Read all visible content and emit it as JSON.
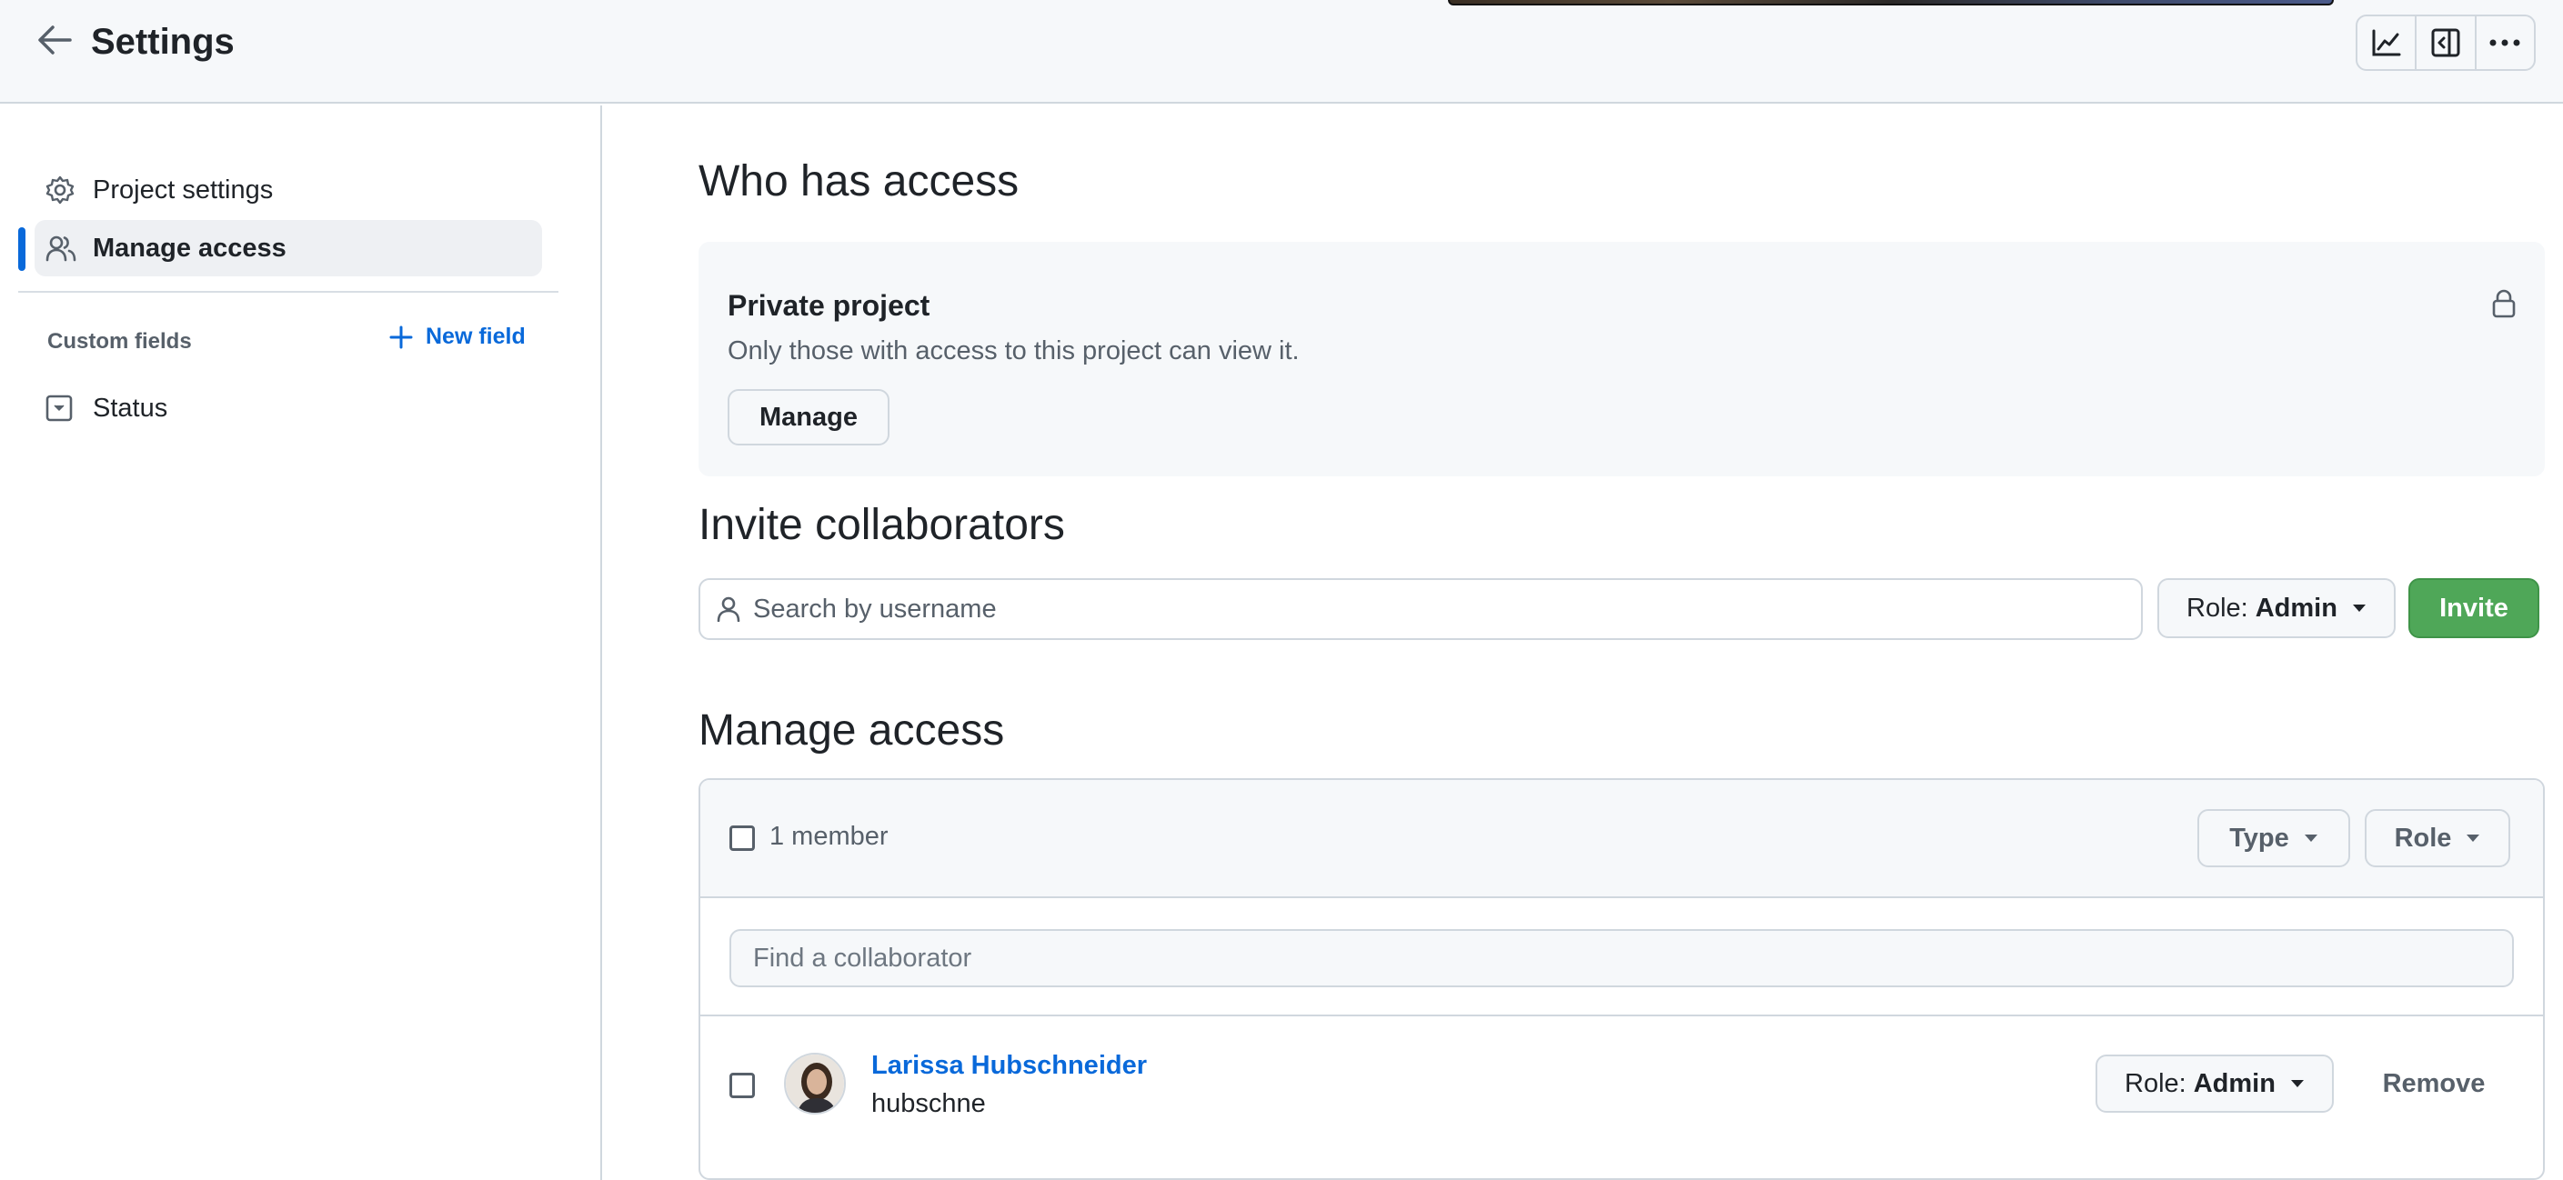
{
  "header": {
    "title": "Settings",
    "back_icon": "arrow-left-icon",
    "tools": [
      "graph-icon",
      "sidebar-expand-icon",
      "kebab-horizontal-icon"
    ]
  },
  "sidebar": {
    "items": [
      {
        "label": "Project settings",
        "icon": "gear-icon",
        "active": false
      },
      {
        "label": "Manage access",
        "icon": "people-icon",
        "active": true
      }
    ],
    "custom_fields_label": "Custom fields",
    "new_field_label": "New field",
    "fields": [
      {
        "label": "Status",
        "icon": "single-select-icon"
      }
    ]
  },
  "main": {
    "who_has_access_heading": "Who has access",
    "private_card": {
      "title": "Private project",
      "description": "Only those with access to this project can view it.",
      "manage_label": "Manage",
      "icon": "lock-icon"
    },
    "invite": {
      "heading": "Invite collaborators",
      "placeholder": "Search by username",
      "role_label": "Role:",
      "role_value": "Admin",
      "invite_label": "Invite"
    },
    "manage_access": {
      "heading": "Manage access",
      "member_count": "1 member",
      "type_filter": "Type",
      "role_filter": "Role",
      "find_placeholder": "Find a collaborator",
      "members": [
        {
          "name": "Larissa Hubschneider",
          "username": "hubschne",
          "role_label": "Role:",
          "role_value": "Admin",
          "remove_label": "Remove"
        }
      ]
    }
  },
  "colors": {
    "accent": "#0969da",
    "invite_green": "#4fa758",
    "header_bg": "#f6f8fa",
    "border": "#d0d7de"
  }
}
